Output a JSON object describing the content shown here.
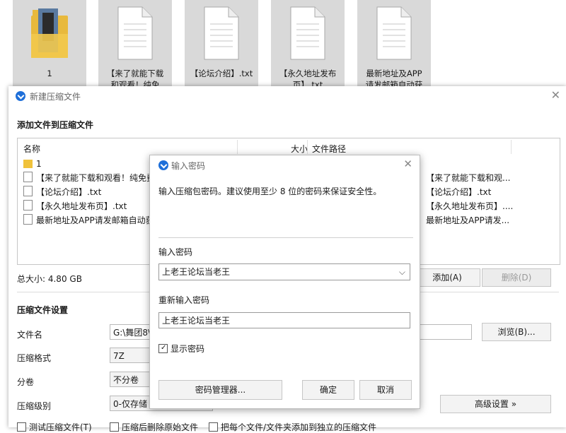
{
  "explorer": {
    "items": [
      {
        "label_l1": "1",
        "label_l2": ""
      },
      {
        "label_l1": "【来了就能下载",
        "label_l2": "和观看！纯免"
      },
      {
        "label_l1": "【论坛介绍】.txt",
        "label_l2": ""
      },
      {
        "label_l1": "【永久地址发布",
        "label_l2": "页】.txt"
      },
      {
        "label_l1": "最新地址及APP",
        "label_l2": "请发邮箱自动获"
      }
    ]
  },
  "window": {
    "title": "新建压缩文件",
    "close": "✕",
    "add_section": "添加文件到压缩文件",
    "columns": {
      "name": "名称",
      "size": "大小",
      "path": "文件路径"
    },
    "files": [
      {
        "name": "1",
        "path": ""
      },
      {
        "name": "【来了就能下载和观看！纯免费",
        "path": "【来了就能下载和观..."
      },
      {
        "name": "【论坛介绍】.txt",
        "path": "【论坛介绍】.txt"
      },
      {
        "name": "【永久地址发布页】.txt",
        "path": "【永久地址发布页】...."
      },
      {
        "name": "最新地址及APP请发邮箱自动获",
        "path": "最新地址及APP请发..."
      }
    ],
    "total_size": "总大小: 4.80 GB",
    "add_button": "添加(A)",
    "delete_button": "删除(D)",
    "settings_section": "压缩文件设置",
    "filename_label": "文件名",
    "filename_value": "G:\\舞团8\\",
    "browse_button": "浏览(B)...",
    "format_label": "压缩格式",
    "format_value": "7Z",
    "split_label": "分卷",
    "split_value": "不分卷",
    "level_label": "压缩级别",
    "level_value": "0-仅存储",
    "advanced_button": "高级设置 »",
    "opt_test": "测试压缩文件(T)",
    "opt_delete": "压缩后删除原始文件",
    "opt_separate": "把每个文件/文件夹添加到独立的压缩文件"
  },
  "password_dialog": {
    "title": "输入密码",
    "close": "✕",
    "hint": "输入压缩包密码。建议使用至少 8 位的密码来保证安全性。",
    "enter_label": "输入密码",
    "enter_value": "上老王论坛当老王",
    "reenter_label": "重新输入密码",
    "reenter_value": "上老王论坛当老王",
    "show_password": "显示密码",
    "manager_button": "密码管理器...",
    "ok_button": "确定",
    "cancel_button": "取消"
  }
}
